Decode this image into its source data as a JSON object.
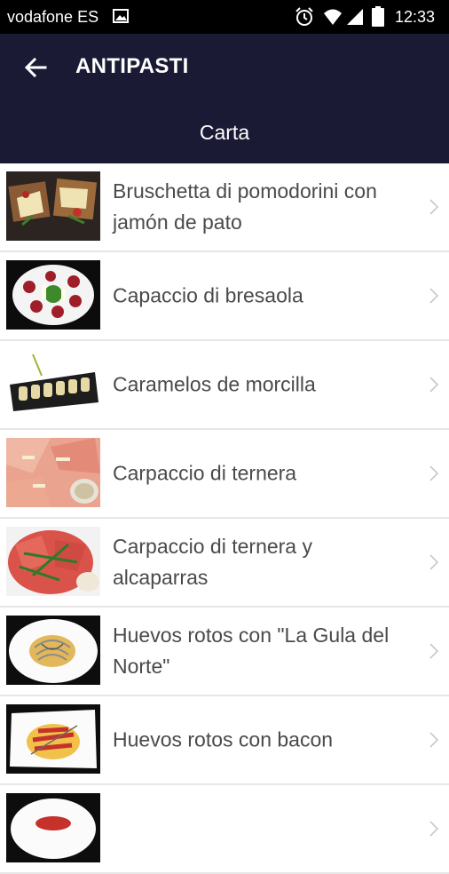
{
  "status_bar": {
    "carrier": "vodafone ES",
    "time": "12:33"
  },
  "app_bar": {
    "title": "ANTIPASTI"
  },
  "sub_header": {
    "title": "Carta"
  },
  "colors": {
    "header_background": "#1b1a35",
    "status_background": "#000000",
    "text": "#4a4a4a",
    "divider": "#e6e6e6"
  },
  "menu_items": [
    {
      "label": "Bruschetta di pomodorini con jamón de pato",
      "icon": "dish-photo"
    },
    {
      "label": "Capaccio di bresaola",
      "icon": "dish-photo"
    },
    {
      "label": "Caramelos de morcilla",
      "icon": "dish-photo"
    },
    {
      "label": "Carpaccio di ternera",
      "icon": "dish-photo"
    },
    {
      "label": "Carpaccio di ternera y alcaparras",
      "icon": "dish-photo"
    },
    {
      "label": "Huevos rotos con \"La Gula del Norte\"",
      "icon": "dish-photo"
    },
    {
      "label": "Huevos rotos con bacon",
      "icon": "dish-photo"
    },
    {
      "label": "",
      "icon": "dish-photo"
    }
  ]
}
